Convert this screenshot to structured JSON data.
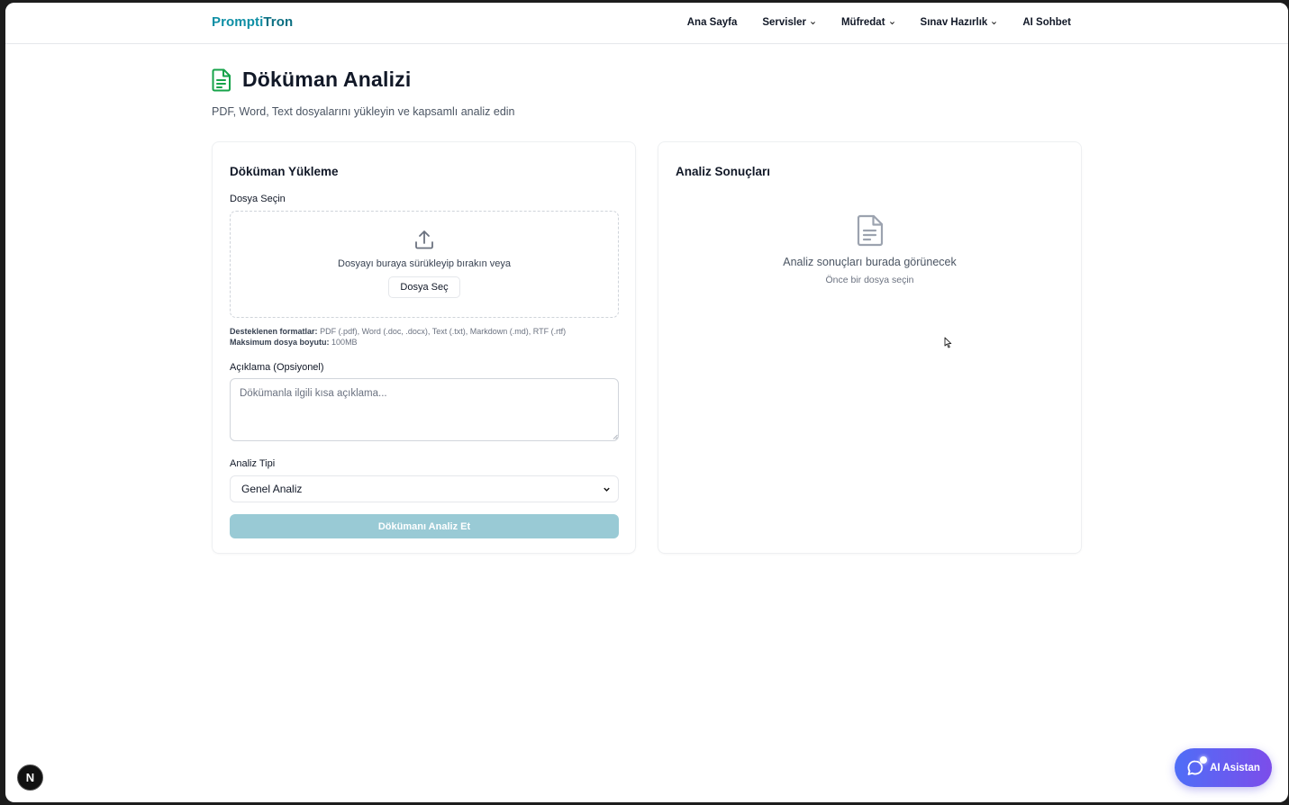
{
  "navbar": {
    "brand_part1": "Prompti",
    "brand_part2": "Tron",
    "items": [
      {
        "label": "Ana Sayfa",
        "has_dropdown": false
      },
      {
        "label": "Servisler",
        "has_dropdown": true
      },
      {
        "label": "Müfredat",
        "has_dropdown": true
      },
      {
        "label": "Sınav Hazırlık",
        "has_dropdown": true
      },
      {
        "label": "AI Sohbet",
        "has_dropdown": false
      }
    ]
  },
  "page": {
    "title": "Döküman Analizi",
    "subtitle": "PDF, Word, Text dosyalarını yükleyin ve kapsamlı analiz edin",
    "icon": "document-icon"
  },
  "upload_card": {
    "title": "Döküman Yükleme",
    "file_label": "Dosya Seçin",
    "drop_text": "Dosyayı buraya sürükleyip bırakın veya",
    "choose_button": "Dosya Seç",
    "formats_label": "Desteklenen formatlar:",
    "formats_value": "PDF (.pdf), Word (.doc, .docx), Text (.txt), Markdown (.md), RTF (.rtf)",
    "max_size_label": "Maksimum dosya boyutu:",
    "max_size_value": "100MB",
    "description_label": "Açıklama (Opsiyonel)",
    "description_placeholder": "Dökümanla ilgili kısa açıklama...",
    "description_value": "",
    "analysis_type_label": "Analiz Tipi",
    "analysis_type_selected": "Genel Analiz",
    "submit_label": "Dökümanı Analiz Et",
    "submit_disabled": true
  },
  "results_card": {
    "title": "Analiz Sonuçları",
    "empty_title": "Analiz sonuçları burada görünecek",
    "empty_subtitle": "Önce bir dosya seçin"
  },
  "floating": {
    "dev_badge": "N",
    "ai_assistant_label": "AI Asistan"
  },
  "colors": {
    "brand_accent": "#0e8fa5",
    "title_icon": "#16a34a",
    "submit_disabled_bg": "#99cad5",
    "ai_gradient_start": "#4f6ef7",
    "ai_gradient_end": "#7c4dea"
  }
}
